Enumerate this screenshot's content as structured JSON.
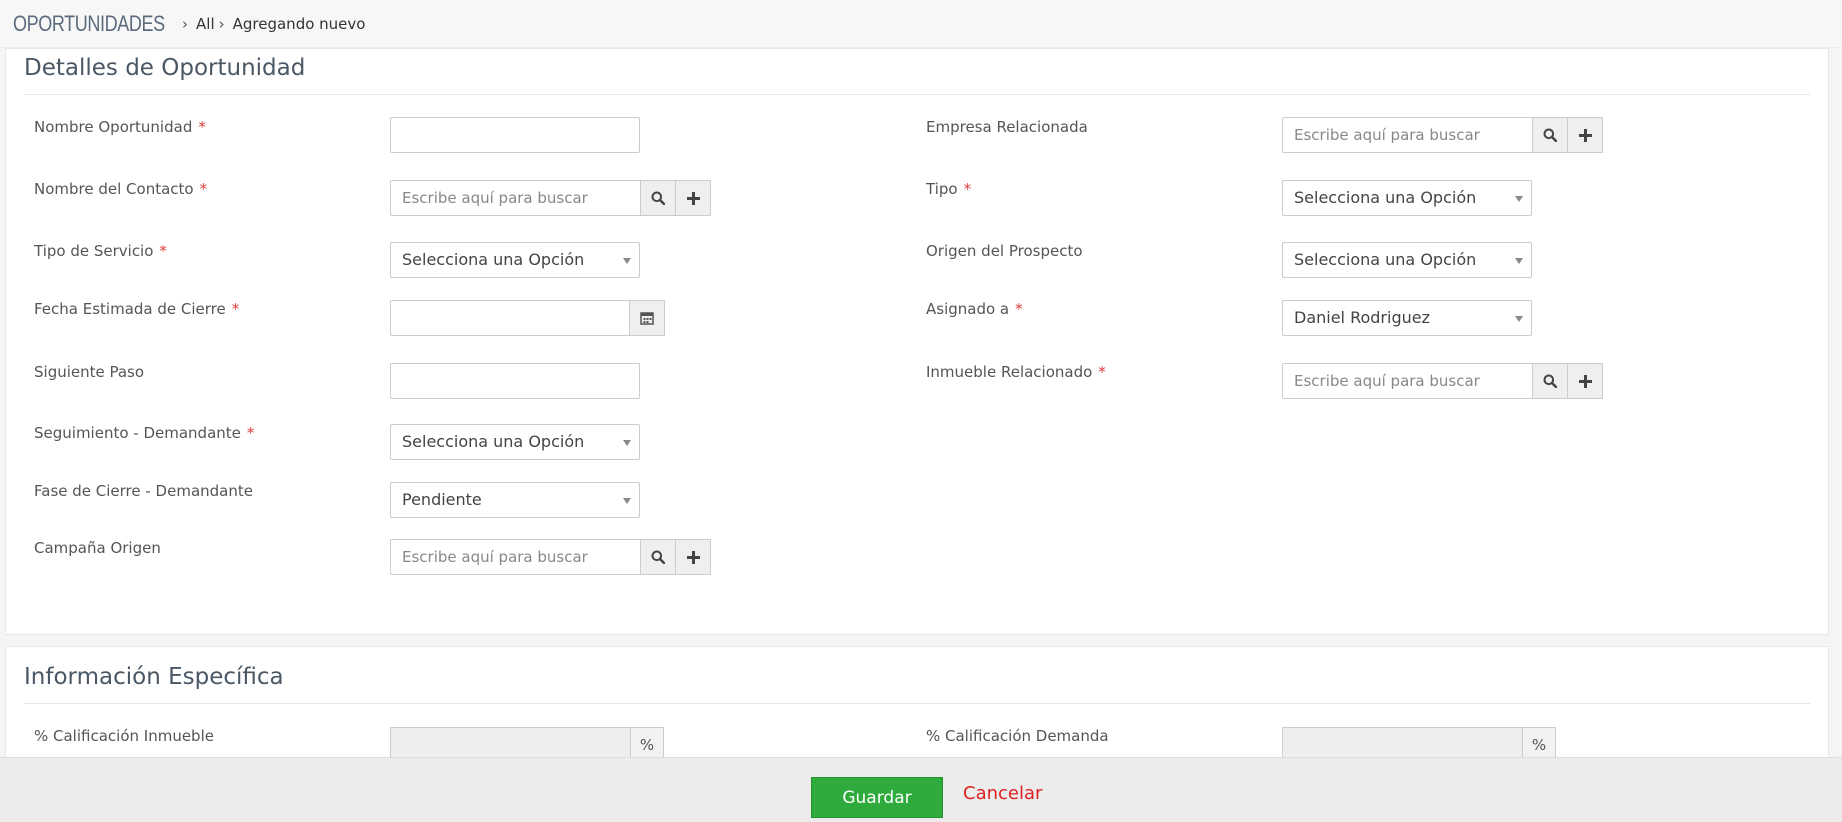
{
  "breadcrumb": {
    "module": "OPORTUNIDADES",
    "all": "All",
    "current": "Agregando nuevo"
  },
  "lookup_placeholder": "Escribe aquí para buscar",
  "section1": {
    "title": "Detalles de Oportunidad",
    "fields": {
      "nombre_oportunidad": {
        "label": "Nombre Oportunidad",
        "required": "*",
        "value": ""
      },
      "nombre_contacto": {
        "label": "Nombre del Contacto",
        "required": "*"
      },
      "tipo_servicio": {
        "label": "Tipo de Servicio",
        "required": "*",
        "value": "Selecciona una Opción"
      },
      "fecha_cierre": {
        "label": "Fecha Estimada de Cierre",
        "required": "*",
        "value": ""
      },
      "siguiente_paso": {
        "label": "Siguiente Paso",
        "value": ""
      },
      "seguimiento": {
        "label": "Seguimiento - Demandante",
        "required": "*",
        "value": "Selecciona una Opción"
      },
      "fase_cierre": {
        "label": "Fase de Cierre - Demandante",
        "value": "Pendiente"
      },
      "campana_origen": {
        "label": "Campaña Origen"
      },
      "empresa_relacionada": {
        "label": "Empresa Relacionada"
      },
      "tipo": {
        "label": "Tipo",
        "required": "*",
        "value": "Selecciona una Opción"
      },
      "origen_prospecto": {
        "label": "Origen del Prospecto",
        "value": "Selecciona una Opción"
      },
      "asignado_a": {
        "label": "Asignado a",
        "required": "*",
        "value": "Daniel Rodriguez"
      },
      "inmueble_relacionado": {
        "label": "Inmueble Relacionado",
        "required": "*"
      }
    }
  },
  "section2": {
    "title": "Información Específica",
    "fields": {
      "calificacion_inmueble": {
        "label": "% Calificación Inmueble",
        "addon": "%"
      },
      "calificacion_demanda": {
        "label": "% Calificación Demanda",
        "addon": "%"
      }
    }
  },
  "footer": {
    "save_label": "Guardar",
    "cancel_label": "Cancelar"
  },
  "colors": {
    "save_button": "#2eab3c",
    "cancel_link": "#e02020",
    "required_mark": "#e03a3a"
  }
}
